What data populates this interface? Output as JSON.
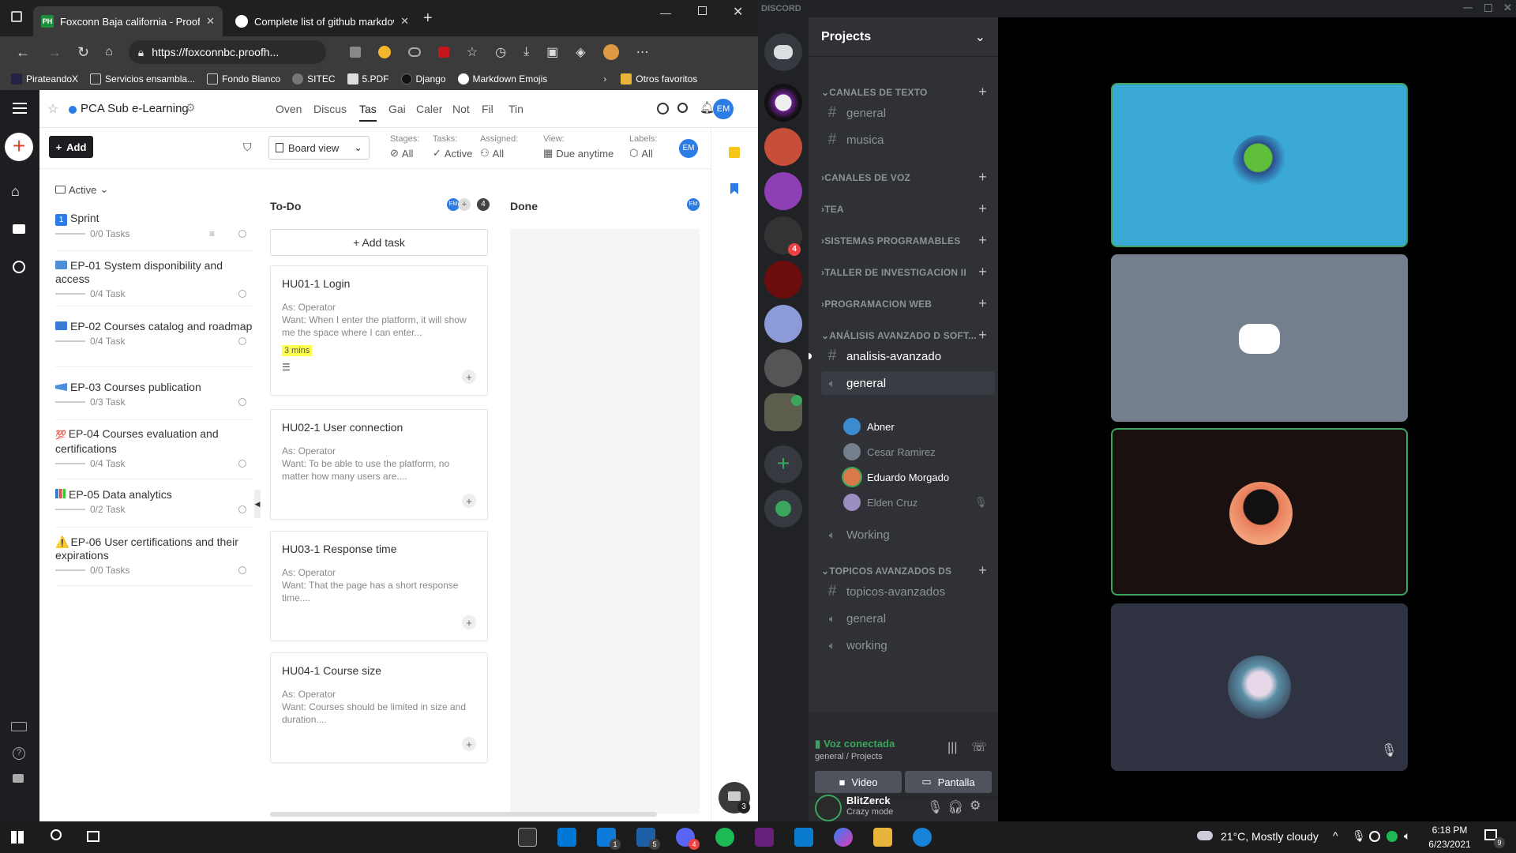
{
  "browser": {
    "tabs": [
      {
        "title": "Foxconn Baja california - ProofH"
      },
      {
        "title": "Complete list of github markdow"
      }
    ],
    "url": "https://foxconnbc.proofh...",
    "favorites": [
      "PirateandoX",
      "Servicios ensambla...",
      "Fondo Blanco",
      "SITEC",
      "5.PDF",
      "Django",
      "Markdown Emojis"
    ],
    "other_favorites": "Otros favoritos"
  },
  "proofhub": {
    "project": "PCA Sub e-Learning",
    "nav": [
      "Oven",
      "Discus",
      "Tas",
      "Gai",
      "Caler",
      "Not",
      "Fil",
      "Tin"
    ],
    "avatar": "EM",
    "add_label": "Add",
    "board_view": "Board view",
    "filters": [
      {
        "label": "Stages:",
        "value": "All"
      },
      {
        "label": "Tasks:",
        "value": "Active"
      },
      {
        "label": "Assigned:",
        "value": "All"
      },
      {
        "label": "View:",
        "value": "Due anytime"
      },
      {
        "label": "Labels:",
        "value": "All"
      }
    ],
    "active_label": "Active",
    "epics": [
      {
        "title": "Sprint",
        "tasks": "0/0 Tasks",
        "emoji": "1"
      },
      {
        "title": "EP-01 System disponibility and access",
        "tasks": "0/4 Task"
      },
      {
        "title": "EP-02 Courses catalog and roadmap",
        "tasks": "0/4 Task"
      },
      {
        "title": "EP-03 Courses publication",
        "tasks": "0/3 Task"
      },
      {
        "title": "EP-04 Courses evaluation and certifications",
        "tasks": "0/4 Task",
        "emoji": "💯"
      },
      {
        "title": "EP-05 Data analytics",
        "tasks": "0/2 Task"
      },
      {
        "title": "EP-06 User certifications and their expirations",
        "tasks": "0/0 Tasks",
        "emoji": "⚠️"
      }
    ],
    "columns": [
      {
        "name": "To-Do",
        "count": "4"
      },
      {
        "name": "Done"
      }
    ],
    "add_task": "+ Add task",
    "cards": [
      {
        "title": "HU01-1 Login",
        "as": "As: Operator",
        "want": "Want: When I enter the platform, it will show me the space where I can enter...",
        "time": "3 mins"
      },
      {
        "title": "HU02-1 User connection",
        "as": "As: Operator",
        "want": "Want: To be able to use the platform, no matter how many users are...."
      },
      {
        "title": "HU03-1 Response time",
        "as": "As: Operator",
        "want": "Want: That the page has a short response time...."
      },
      {
        "title": "HU04-1 Course size",
        "as": "As: Operator",
        "want": "Want: Courses should be limited in size and duration...."
      }
    ],
    "chat_badge": "3"
  },
  "discord": {
    "title": "DISCORD",
    "server_name": "Projects",
    "server_badge": "4",
    "categories": {
      "texto": "CANALES DE TEXTO",
      "voz": "CANALES DE VOZ",
      "tea": "TEA",
      "sistemas": "SISTEMAS PROGRAMABLES",
      "taller": "TALLER DE INVESTIGACION II",
      "web": "PROGRAMACION WEB",
      "analisis": "ANÁLISIS AVANZADO D SOFT...",
      "topicos": "TOPICOS AVANZADOS DS"
    },
    "channels": {
      "general1": "general",
      "musica": "musica",
      "analisis": "analisis-avanzado",
      "general_voice": "general",
      "working1": "Working",
      "topicos": "topicos-avanzados",
      "general2": "general",
      "working2": "working"
    },
    "voice_users": [
      "Abner",
      "Cesar Ramirez",
      "Eduardo Morgado",
      "Elden Cruz"
    ],
    "voice_status": "Voz conectada",
    "voice_channel": "general / Projects",
    "video_btn": "Video",
    "screen_btn": "Pantalla",
    "user": {
      "name": "BlitZerck",
      "status": "Crazy mode"
    }
  },
  "taskbar": {
    "weather": "21°C, Mostly cloudy",
    "time": "6:18 PM",
    "date": "6/23/2021",
    "notif": "9",
    "badges": [
      "1",
      "5",
      "4"
    ]
  },
  "colors": {
    "ph_blue": "#2d7be5",
    "discord_green": "#3ba55d",
    "discord_blurple": "#5865f2"
  }
}
